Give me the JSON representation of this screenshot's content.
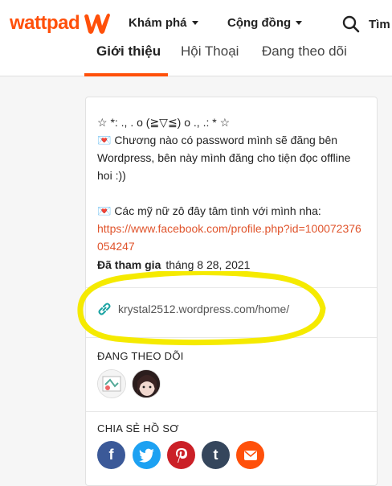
{
  "header": {
    "logo_text": "wattpad",
    "nav": [
      {
        "label": "Khám phá"
      },
      {
        "label": "Cộng đồng"
      }
    ],
    "search_label": "Tìm"
  },
  "tabs": [
    {
      "label": "Giới thiệu",
      "active": true
    },
    {
      "label": "Hội Thoại",
      "active": false
    },
    {
      "label": "Đang theo dõi",
      "active": false
    }
  ],
  "profile": {
    "about_line1": "☆ *: ., . o (≧▽≦) o ., .: * ☆",
    "about_line2": "💌 Chương nào có password mình sẽ đăng bên Wordpress, bên này mình đăng cho tiện đọc offline hoi :))",
    "about_line3": "💌 Các mỹ nữ zô đây tâm tình với mình nha:",
    "about_link": "https://www.facebook.com/profile.php?id=100072376054247",
    "joined_label": "Đã tham gia",
    "joined_date": "tháng 8 28, 2021",
    "website": "krystal2512.wordpress.com/home/"
  },
  "following": {
    "title": "ĐANG THEO DÕI"
  },
  "share": {
    "title": "CHIA SẺ HỒ SƠ",
    "buttons": [
      {
        "name": "facebook",
        "glyph": "f",
        "color": "#3b5998"
      },
      {
        "name": "twitter",
        "glyph": "t",
        "color": "#1da1f2"
      },
      {
        "name": "pinterest",
        "glyph": "P",
        "color": "#cb2027"
      },
      {
        "name": "tumblr",
        "glyph": "t",
        "color": "#35465c"
      },
      {
        "name": "email",
        "glyph": "✉",
        "color": "#ff500a"
      }
    ]
  },
  "colors": {
    "brand": "#ff500a",
    "link": "#e0542c",
    "highlight": "#f5ea00"
  }
}
